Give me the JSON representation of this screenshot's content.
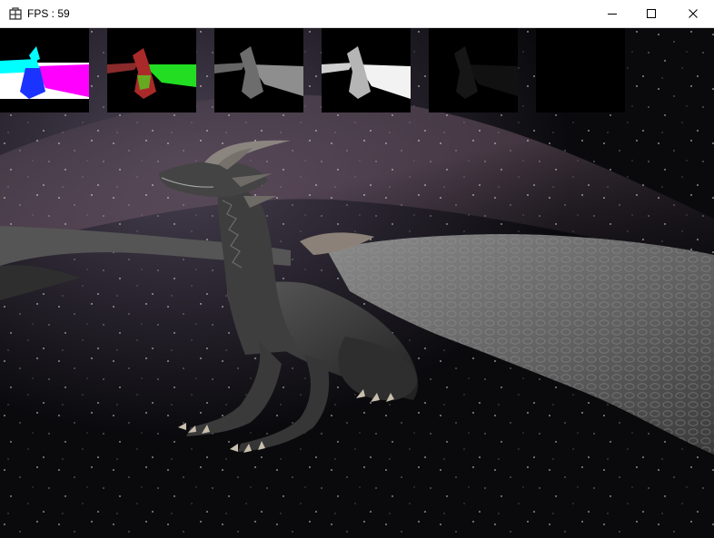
{
  "window": {
    "title": "FPS : 59",
    "icon": "app-grid-icon",
    "controls": {
      "minimize_icon": "minimize-icon",
      "maximize_icon": "maximize-icon",
      "close_icon": "close-icon"
    }
  },
  "scene": {
    "subject": "dragon",
    "background": "starfield-nebula",
    "buffers": [
      {
        "name": "position-buffer",
        "tint": "#00ffff"
      },
      {
        "name": "normal-buffer",
        "tint": "#00ff00"
      },
      {
        "name": "albedo-buffer",
        "tint": "#9a9a9a"
      },
      {
        "name": "lighting-buffer",
        "tint": "#ffffff"
      },
      {
        "name": "specular-buffer",
        "tint": "#1a1a1a"
      },
      {
        "name": "empty-buffer",
        "tint": "#000000"
      }
    ]
  }
}
